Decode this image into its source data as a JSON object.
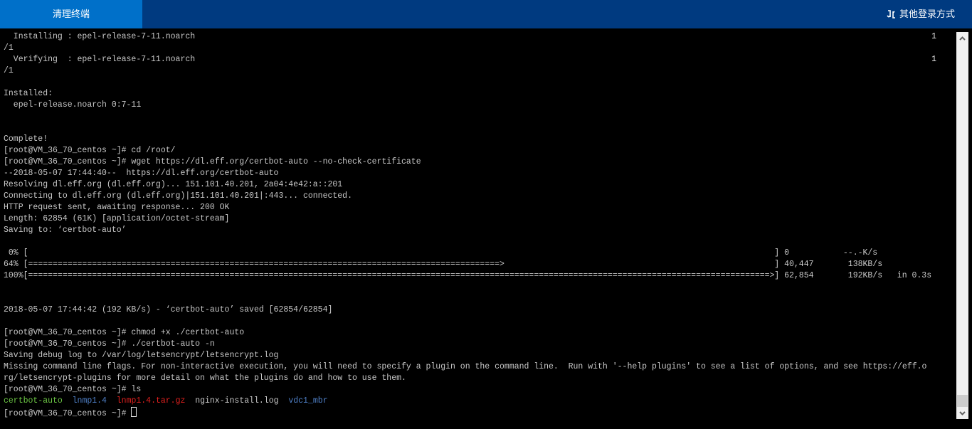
{
  "header": {
    "clear_terminal_label": "清理终端",
    "other_login_label": "其他登录方式"
  },
  "colors": {
    "header_bg": "#003a80",
    "active_tab": "#0070c9",
    "green": "#6cc644",
    "blue": "#4f80c8",
    "red": "#e0201e"
  },
  "terminal": {
    "lines": [
      {
        "text": "  Installing : epel-release-7-11.noarch",
        "right": "1"
      },
      {
        "text": "/1"
      },
      {
        "text": "  Verifying  : epel-release-7-11.noarch",
        "right": "1"
      },
      {
        "text": "/1"
      },
      {
        "text": ""
      },
      {
        "text": "Installed:"
      },
      {
        "text": "  epel-release.noarch 0:7-11"
      },
      {
        "text": ""
      },
      {
        "text": ""
      },
      {
        "text": "Complete!"
      },
      {
        "text": "[root@VM_36_70_centos ~]# cd /root/"
      },
      {
        "text": "[root@VM_36_70_centos ~]# wget https://dl.eff.org/certbot-auto --no-check-certificate"
      },
      {
        "text": "--2018-05-07 17:44:40--  https://dl.eff.org/certbot-auto"
      },
      {
        "text": "Resolving dl.eff.org (dl.eff.org)... 151.101.40.201, 2a04:4e42:a::201"
      },
      {
        "text": "Connecting to dl.eff.org (dl.eff.org)|151.101.40.201|:443... connected."
      },
      {
        "text": "HTTP request sent, awaiting response... 200 OK"
      },
      {
        "text": "Length: 62854 (61K) [application/octet-stream]"
      },
      {
        "text": "Saving to: ‘certbot-auto’"
      },
      {
        "text": ""
      },
      {
        "progress": {
          "pct": " 0% [",
          "bar": "",
          "received": "] 0",
          "speed": "--.-K/s",
          "eta": ""
        }
      },
      {
        "progress": {
          "pct": "64% [",
          "bar": "================================================================================================>",
          "received": "] 40,447",
          "speed": " 138KB/s",
          "eta": ""
        }
      },
      {
        "progress": {
          "pct": "100%[",
          "bar": "=======================================================================================================================================================>",
          "received": "] 62,854",
          "speed": " 192KB/s",
          "eta": "in 0.3s"
        }
      },
      {
        "text": ""
      },
      {
        "text": ""
      },
      {
        "text": "2018-05-07 17:44:42 (192 KB/s) - ‘certbot-auto’ saved [62854/62854]"
      },
      {
        "text": ""
      },
      {
        "text": "[root@VM_36_70_centos ~]# chmod +x ./certbot-auto"
      },
      {
        "text": "[root@VM_36_70_centos ~]# ./certbot-auto -n"
      },
      {
        "text": "Saving debug log to /var/log/letsencrypt/letsencrypt.log"
      },
      {
        "text": "Missing command line flags. For non-interactive execution, you will need to specify a plugin on the command line.  Run with '--help plugins' to see a list of options, and see https://eff.o"
      },
      {
        "text": "rg/letsencrypt-plugins for more detail on what the plugins do and how to use them."
      },
      {
        "text": "[root@VM_36_70_centos ~]# ls"
      },
      {
        "segments": [
          {
            "text": "certbot-auto",
            "color": "g"
          },
          {
            "text": "  ",
            "color": "w"
          },
          {
            "text": "lnmp1.4",
            "color": "b"
          },
          {
            "text": "  ",
            "color": "w"
          },
          {
            "text": "lnmp1.4.tar.gz",
            "color": "r"
          },
          {
            "text": "  ",
            "color": "w"
          },
          {
            "text": "nginx-install.log",
            "color": "w"
          },
          {
            "text": "  ",
            "color": "w"
          },
          {
            "text": "vdc1_mbr",
            "color": "b"
          }
        ]
      },
      {
        "text": "[root@VM_36_70_centos ~]# ",
        "cursor": true
      }
    ]
  }
}
